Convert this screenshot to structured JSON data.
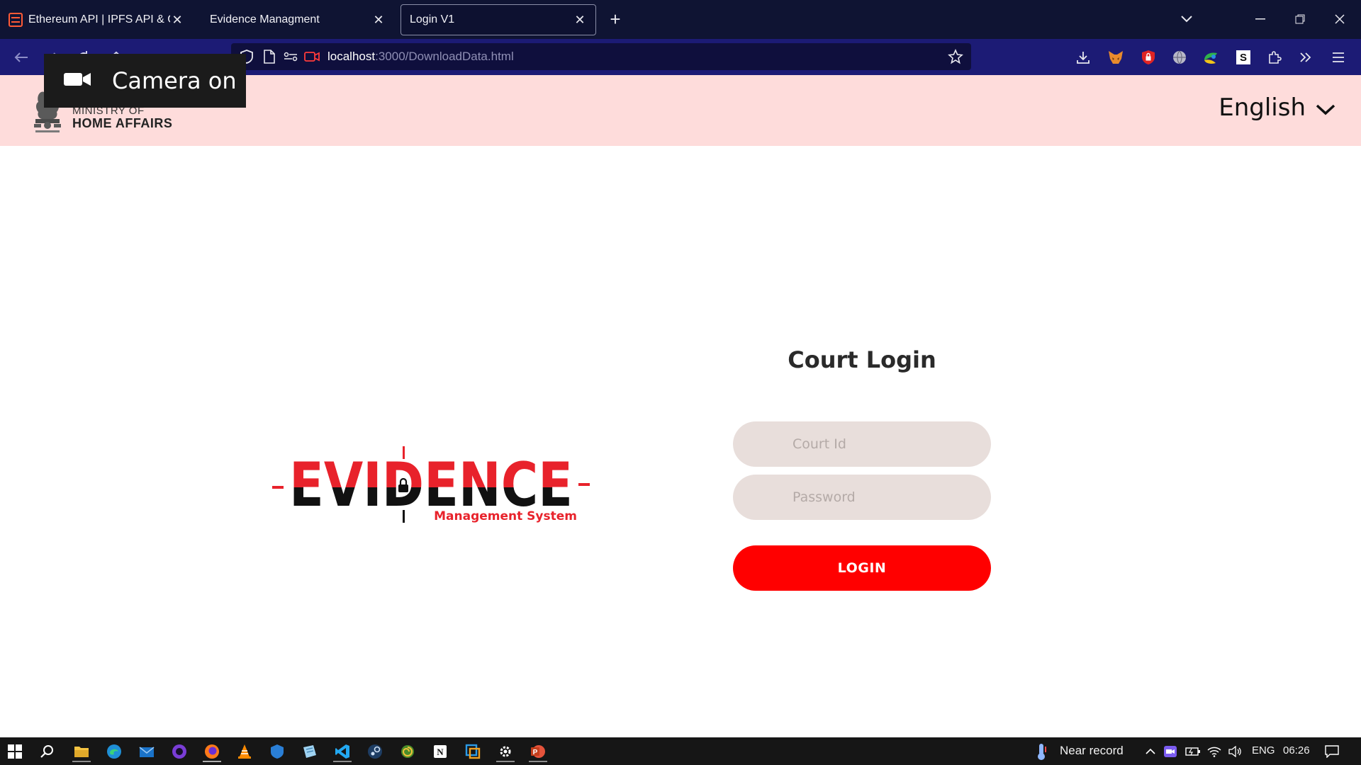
{
  "browser": {
    "tabs": [
      {
        "title": "Ethereum API | IPFS API & Gatew",
        "active": false
      },
      {
        "title": "Evidence Managment",
        "active": false
      },
      {
        "title": "Login V1",
        "active": true
      }
    ],
    "url_host": "localhost",
    "url_rest": ":3000/DownloadData.html"
  },
  "camera_overlay": {
    "label": "Camera on"
  },
  "header": {
    "ministry_line1": "MINISTRY OF",
    "ministry_line2": "HOME AFFAIRS",
    "language": "English"
  },
  "logo": {
    "word": "EVIDENCE",
    "subtitle": "Management System",
    "colors": {
      "red": "#e8222b",
      "black": "#111111"
    }
  },
  "login": {
    "title": "Court Login",
    "court_id_placeholder": "Court Id",
    "password_placeholder": "Password",
    "button_label": "LOGIN"
  },
  "taskbar": {
    "weather_text": "Near record",
    "language": "ENG",
    "time": "06:26"
  },
  "colors": {
    "tabstrip": "#0f1433",
    "navbar": "#1c1b75",
    "header_bg": "#fedcdb",
    "input_bg": "#e8dedb",
    "login_button": "#ff0000"
  }
}
